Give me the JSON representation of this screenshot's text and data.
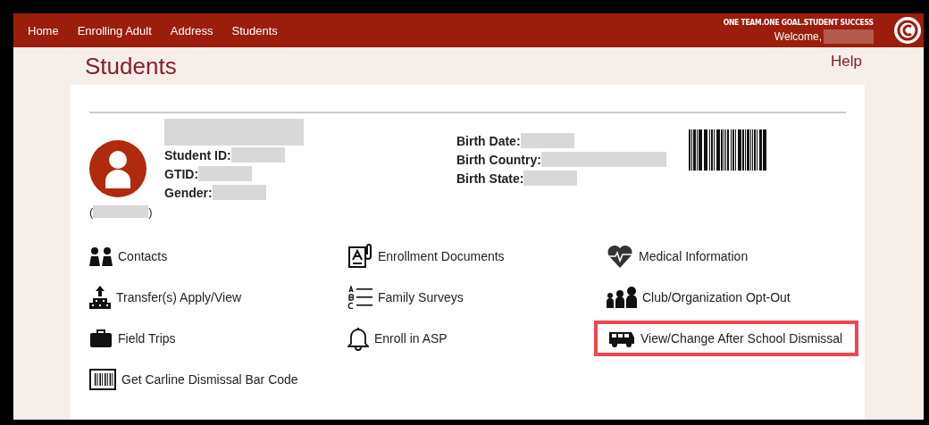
{
  "nav": {
    "links": [
      {
        "label": "Home"
      },
      {
        "label": "Enrolling Adult"
      },
      {
        "label": "Address"
      },
      {
        "label": "Students"
      }
    ],
    "tagline": "ONE TEAM.ONE GOAL.STUDENT SUCCESS",
    "welcome": "Welcome,"
  },
  "page_title": "Students",
  "help": "Help",
  "student": {
    "fields_left": [
      {
        "label": "Student ID:"
      },
      {
        "label": "GTID:"
      },
      {
        "label": "Gender:"
      }
    ],
    "fields_right": [
      {
        "label": "Birth Date:"
      },
      {
        "label": "Birth Country:"
      },
      {
        "label": "Birth State:"
      }
    ],
    "paren_open": "(",
    "paren_close": ")"
  },
  "links": [
    {
      "label": "Contacts",
      "kind": "people",
      "highlighted": false
    },
    {
      "label": "Enrollment Documents",
      "kind": "document",
      "highlighted": false
    },
    {
      "label": "Medical Information",
      "kind": "heart",
      "highlighted": false
    },
    {
      "label": "Transfer(s) Apply/View",
      "kind": "transfer",
      "highlighted": false
    },
    {
      "label": "Family Surveys",
      "kind": "list",
      "highlighted": false
    },
    {
      "label": "Club/Organization Opt-Out",
      "kind": "group",
      "highlighted": false
    },
    {
      "label": "Field Trips",
      "kind": "suitcase",
      "highlighted": false
    },
    {
      "label": "Enroll in ASP",
      "kind": "bell",
      "highlighted": false
    },
    {
      "label": "View/Change After School Dismissal",
      "kind": "bus",
      "highlighted": true
    },
    {
      "label": "Get Carline Dismissal Bar Code",
      "kind": "barcode",
      "highlighted": false
    }
  ]
}
